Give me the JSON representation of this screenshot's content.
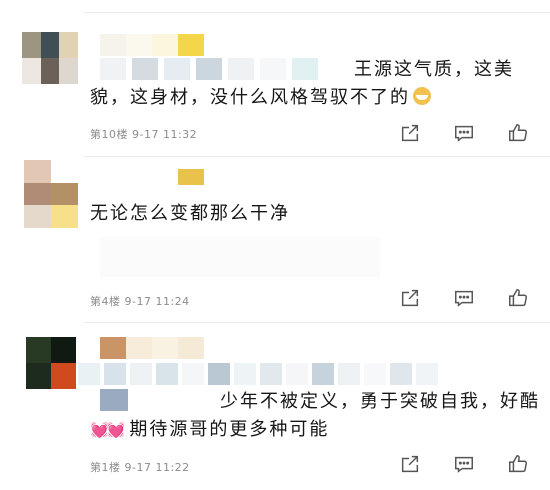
{
  "comments": [
    {
      "text_line1": "王源这气质，这美",
      "text_line2": "貌，这身材，没什么风格驾驭不了的",
      "emoji": "grinning-face",
      "floor": "第10楼",
      "date": "9-17",
      "time": "11:32"
    },
    {
      "text_line1": "无论怎么变都那么干净",
      "floor": "第4楼",
      "date": "9-17",
      "time": "11:24"
    },
    {
      "text_line1": "少年不被定义，勇于突破自我，好酷",
      "text_line2": "期待源哥的更多种可能",
      "hearts": "💓💓",
      "floor": "第1楼",
      "date": "9-17",
      "time": "11:22"
    }
  ],
  "icons": {
    "share": "share-icon",
    "comment": "comment-icon",
    "like": "thumbs-up-icon"
  },
  "colors": {
    "text": "#161616",
    "meta": "#8c8c8c",
    "divider": "#ebebeb"
  }
}
